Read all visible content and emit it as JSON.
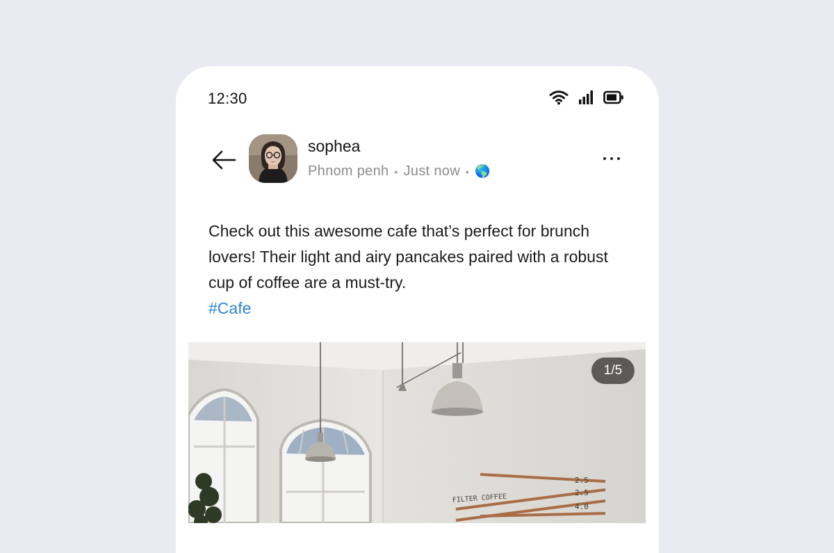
{
  "status_bar": {
    "time": "12:30",
    "icons": [
      "wifi-icon",
      "signal-icon",
      "battery-icon"
    ]
  },
  "post_header": {
    "back_icon": "arrow-left-icon",
    "username": "sophea",
    "location": "Phnom penh",
    "timestamp": "Just now",
    "separator": "•",
    "visibility_icon": "🌎",
    "more_icon": "more-horizontal-icon"
  },
  "post": {
    "text": "Check out this awesome cafe that’s perfect for brunch lovers! Their light and airy pancakes paired with a robust cup of coffee are a must-try.",
    "hashtag": "#Cafe"
  },
  "media": {
    "counter": "1/5",
    "menu_board_title": "FILTER COFFEE",
    "prices": [
      "2.5",
      "2.5",
      "4.0"
    ]
  },
  "colors": {
    "background": "#eaebf2",
    "card": "#ffffff",
    "hashtag": "#2d84d3",
    "meta_text": "#8c8c8c"
  }
}
